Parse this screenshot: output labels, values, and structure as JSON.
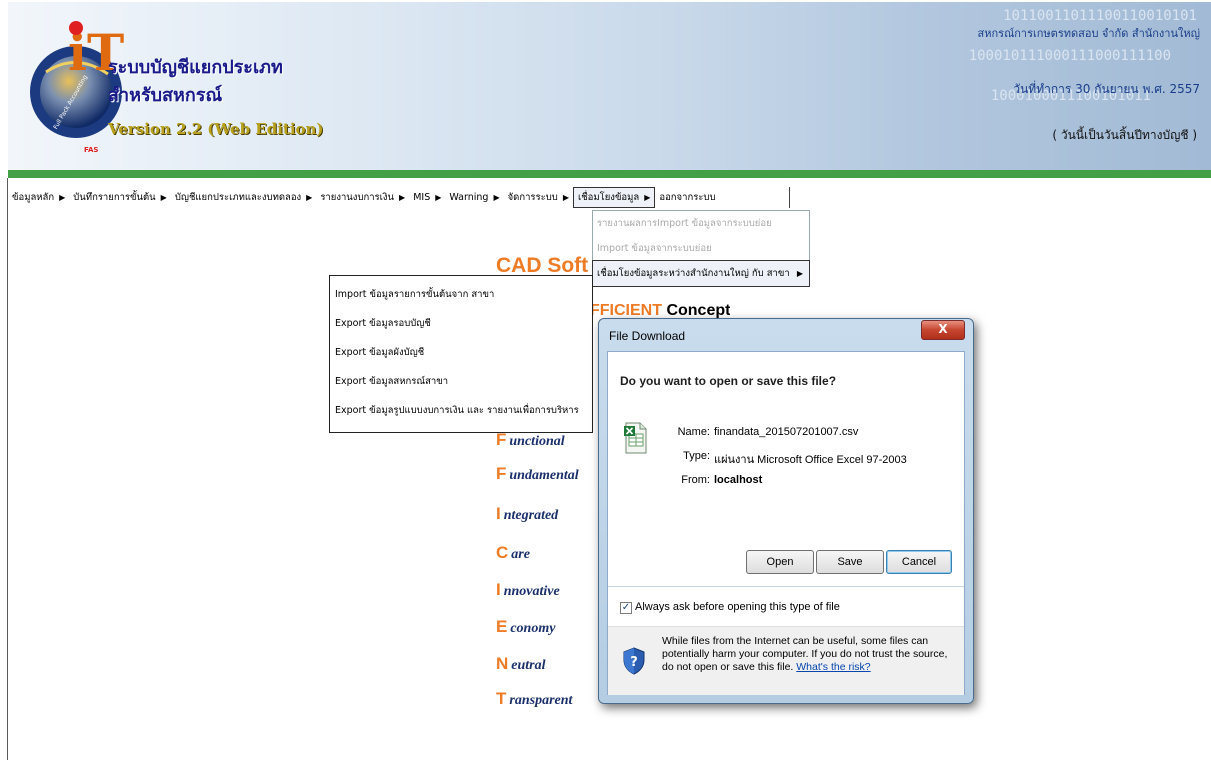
{
  "header": {
    "binary_lines": [
      "10110011011100110010101",
      "100010111000111000111100",
      "1000100011100101011"
    ],
    "system_title_line1": "ระบบบัญชีแยกประเภท",
    "system_title_line2": "สำหรับสหกรณ์",
    "version": "Version 2.2 (Web Edition)",
    "cooperative_name": "สหกรณ์การเกษตรทดสอบ จำกัด สำนักงานใหญ่",
    "work_date": "วันที่ทำการ 30 กันยายน พ.ศ. 2557",
    "period_note": "( วันนี้เป็นวันสิ้นปีทางบัญชี )",
    "logo_ring_text": "Full Pack Accounting Software - FAS",
    "logo_letters": "iT",
    "colors": {
      "accent_green": "#43a047",
      "title_blue": "#1a1a8a",
      "version_gold": "#b8a11f"
    }
  },
  "menu": {
    "items": [
      {
        "label": "ข้อมูลหลัก",
        "arrow": "▶"
      },
      {
        "label": "บันทึกรายการขั้นต้น",
        "arrow": "▶"
      },
      {
        "label": "บัญชีแยกประเภทและงบทดลอง",
        "arrow": "▶"
      },
      {
        "label": "รายงานงบการเงิน",
        "arrow": "▶"
      },
      {
        "label": "MIS",
        "arrow": "▶"
      },
      {
        "label": "Warning",
        "arrow": "▶"
      },
      {
        "label": "จัดการระบบ",
        "arrow": "▶"
      },
      {
        "label": "เชื่อมโยงข้อมูล",
        "arrow": "▶"
      },
      {
        "label": "ออกจากระบบ",
        "arrow": ""
      }
    ],
    "active_index": 7
  },
  "submenu": {
    "items": [
      {
        "label": "รายงานผลการImport ข้อมูลจากระบบย่อย",
        "enabled": false
      },
      {
        "label": "Import ข้อมูลจากระบบย่อย",
        "enabled": false
      },
      {
        "label": "เชื่อมโยงข้อมูลระหว่างสำนักงานใหญ่ กับ สาขา",
        "enabled": true,
        "arrow": "▶"
      }
    ]
  },
  "flyout": {
    "items": [
      "Import ข้อมูลรายการขั้นต้นจาก สาขา",
      "Export ข้อมูลรอบบัญชี",
      "Export ข้อมูลผังบัญชี",
      "Export ข้อมูลสหกรณ์สาขา",
      "Export  ข้อมูลรูปแบบงบการเงิน และ รายงานเพื่อการบริหาร"
    ]
  },
  "background": {
    "cad_title": "CAD Soft",
    "concept_fragment": "FFICIENT",
    "concept_word": "Concept",
    "words": [
      {
        "letter": "F",
        "rest": "unctional"
      },
      {
        "letter": "F",
        "rest": "undamental"
      },
      {
        "letter": "I",
        "rest": "ntegrated"
      },
      {
        "letter": "C",
        "rest": "are"
      },
      {
        "letter": "I",
        "rest": "nnovative"
      },
      {
        "letter": "E",
        "rest": "conomy"
      },
      {
        "letter": "N",
        "rest": "eutral"
      },
      {
        "letter": "T",
        "rest": "ransparent"
      }
    ]
  },
  "dialog": {
    "title": "File Download",
    "close_label": "X",
    "question": "Do you want to open or save this file?",
    "name_label": "Name:",
    "name_value": "finandata_201507201007.csv",
    "type_label": "Type:",
    "type_value": "แผ่นงาน Microsoft Office Excel 97-2003",
    "from_label": "From:",
    "from_value": "localhost",
    "open_label": "Open",
    "save_label": "Save",
    "cancel_label": "Cancel",
    "checkbox_checked": true,
    "checkbox_mark": "✓",
    "checkbox_label": "Always ask before opening this type of file",
    "warning_text": "While files from the Internet can be useful, some files can potentially harm your computer. If you do not trust the source, do not open or save this file.",
    "warning_link": "What's the risk?"
  }
}
